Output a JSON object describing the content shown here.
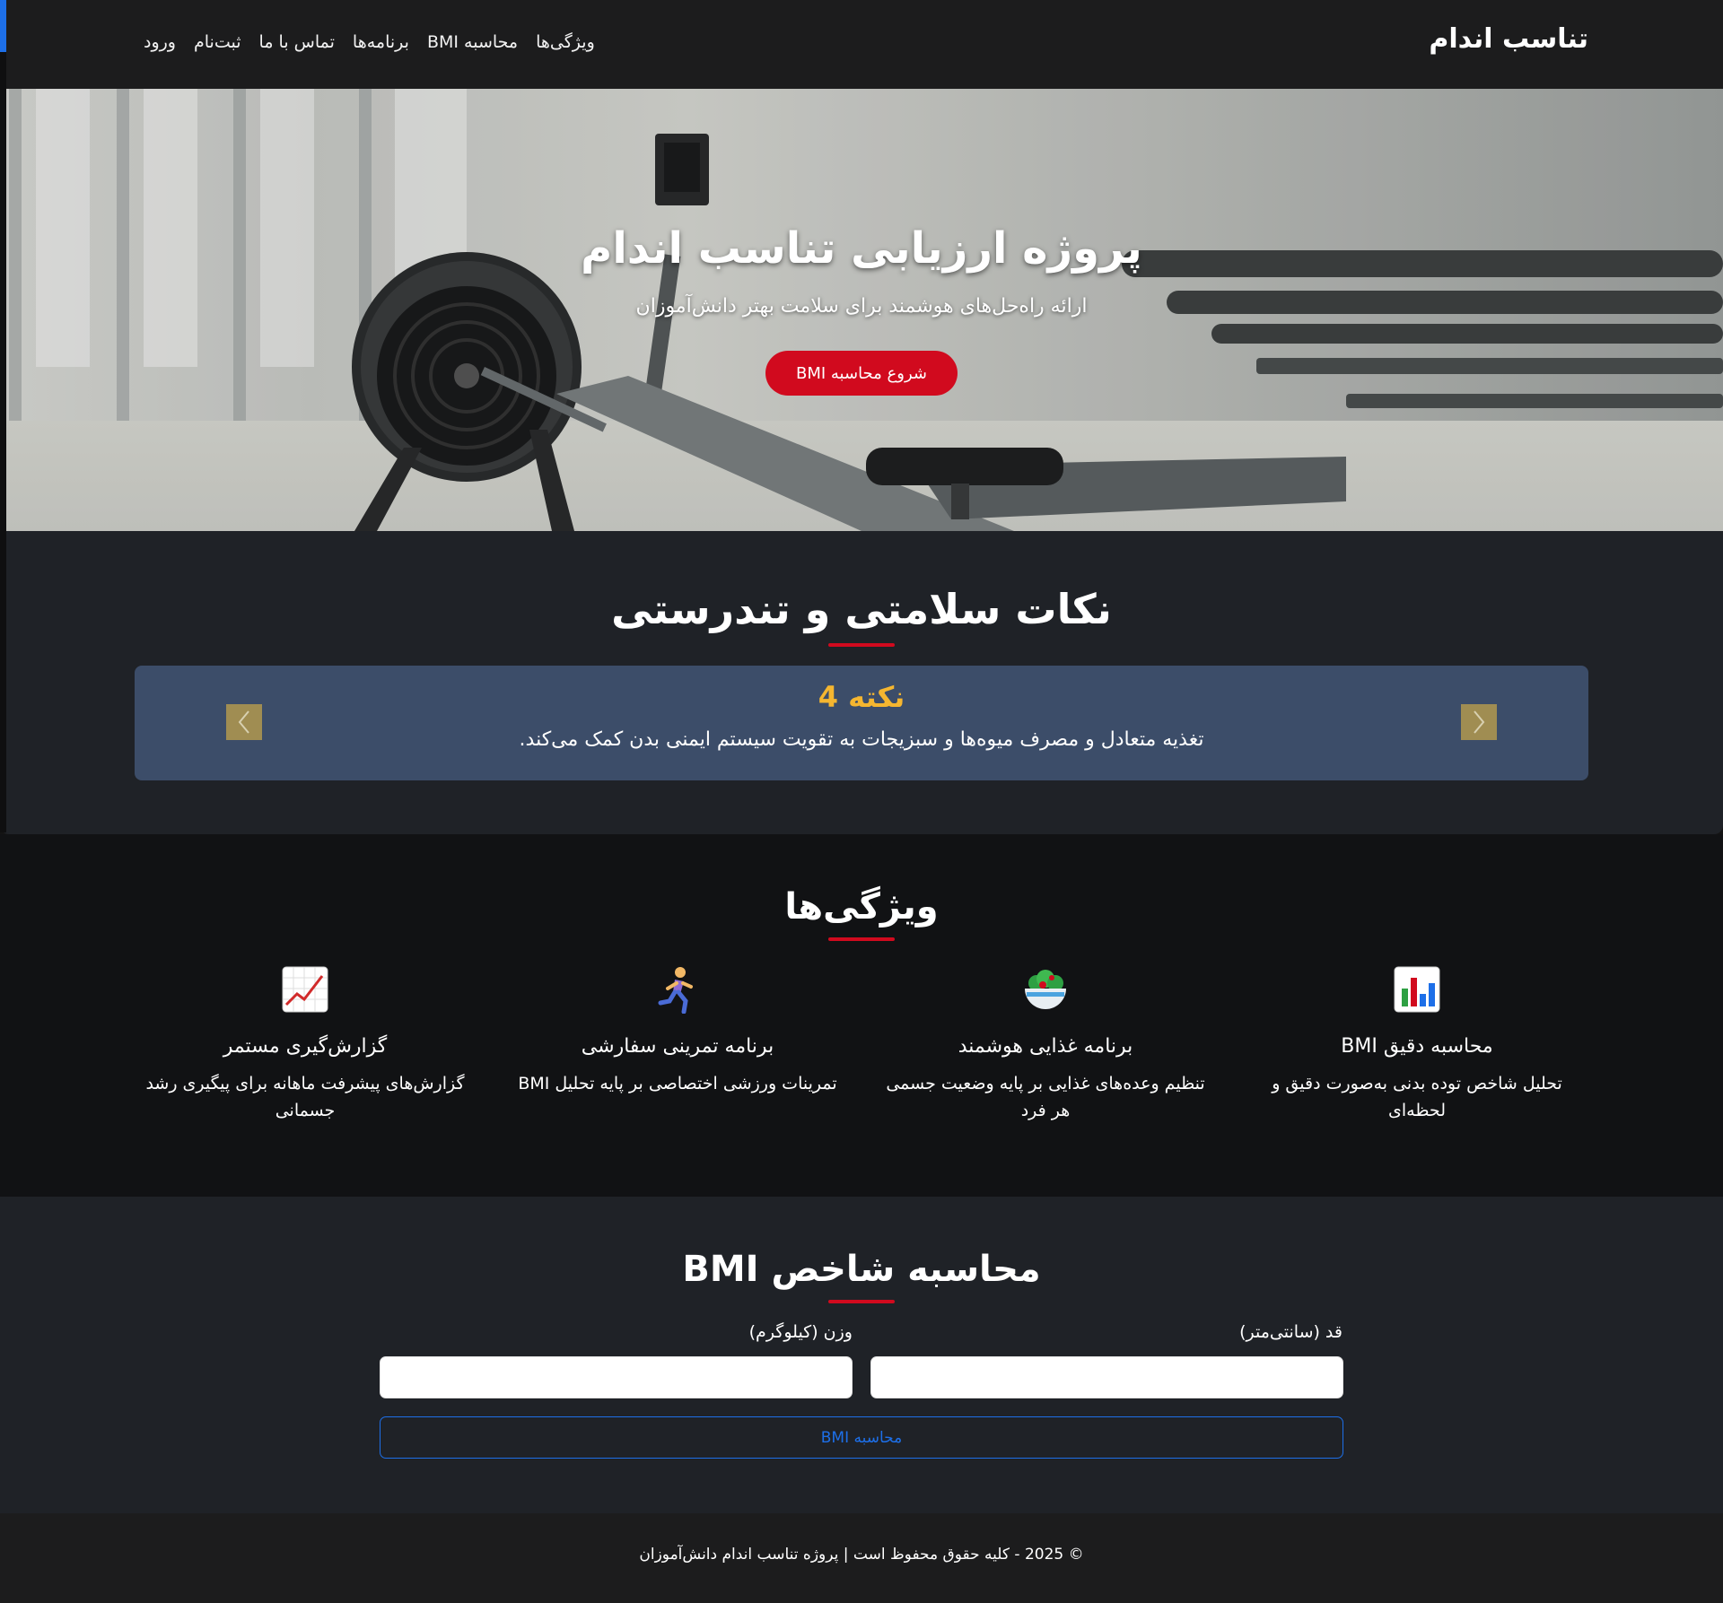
{
  "navbar": {
    "brand": "تناسب اندام",
    "links": [
      "ویژگی‌ها",
      "محاسبه BMI",
      "برنامه‌ها",
      "تماس با ما",
      "ثبت‌نام",
      "ورود"
    ]
  },
  "hero": {
    "title": "پروژه ارزیابی تناسب اندام",
    "subtitle": "ارائه راه‌حل‌های هوشمند برای سلامت بهتر دانش‌آموزان",
    "cta": "شروع محاسبه BMI"
  },
  "tips": {
    "title": "نکات سلامتی و تندرستی",
    "current_title": "نکته 4",
    "current_text": "تغذیه متعادل و مصرف میوه‌ها و سبزیجات به تقویت سیستم ایمنی بدن کمک می‌کند.",
    "accent_color": "#f5b630"
  },
  "features": {
    "title": "ویژگی‌ها",
    "items": [
      {
        "icon": "bar-chart-icon",
        "title": "محاسبه دقیق BMI",
        "desc": "تحلیل شاخص توده بدنی به‌صورت دقیق و لحظه‌ای"
      },
      {
        "icon": "salad-bowl-icon",
        "title": "برنامه غذایی هوشمند",
        "desc": "تنظیم وعده‌های غذایی بر پایه وضعیت جسمی هر فرد"
      },
      {
        "icon": "runner-icon",
        "title": "برنامه تمرینی سفارشی",
        "desc": "تمرینات ورزشی اختصاصی بر پایه تحلیل BMI"
      },
      {
        "icon": "trending-up-chart-icon",
        "title": "گزارش‌گیری مستمر",
        "desc": "گزارش‌های پیشرفت ماهانه برای پیگیری رشد جسمانی"
      }
    ]
  },
  "bmi": {
    "title": "محاسبه شاخص BMI",
    "height_label": "قد (سانتی‌متر)",
    "weight_label": "وزن (کیلوگرم)",
    "height_value": "",
    "weight_value": "",
    "button": "محاسبه BMI"
  },
  "footer": {
    "text": "© 2025 - کلیه حقوق محفوظ است | پروژه تناسب اندام دانش‌آموزان"
  },
  "colors": {
    "accent_red": "#d10a1e",
    "accent_blue": "#1d6fe8",
    "tip_card": "#3c4d69"
  }
}
